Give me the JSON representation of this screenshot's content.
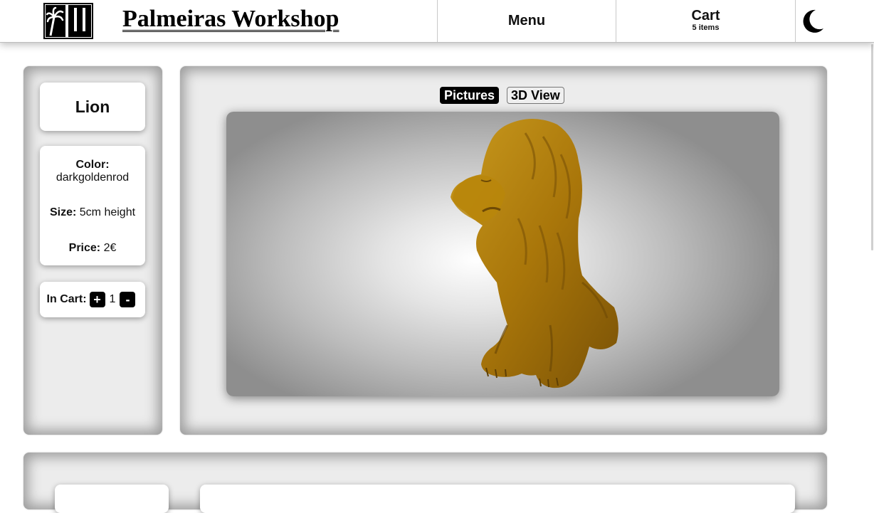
{
  "header": {
    "site_title": "Palmeiras Workshop",
    "menu_label": "Menu",
    "cart_label": "Cart",
    "cart_count": "5 items",
    "logo_icon": "palm-pw-logo-icon",
    "theme_icon": "moon-icon"
  },
  "product": {
    "name": "Lion",
    "color_label": "Color:",
    "color_value": "darkgoldenrod",
    "size_label": "Size:",
    "size_value": "5cm height",
    "price_label": "Price:",
    "price_value": "2€",
    "in_cart_label": "In Cart:",
    "increment_label": "+",
    "quantity": "1",
    "decrement_label": "-",
    "model_color": "#b8860b"
  },
  "viewer": {
    "tabs": [
      {
        "label": "Pictures",
        "active": true
      },
      {
        "label": "3D View",
        "active": false
      }
    ]
  }
}
